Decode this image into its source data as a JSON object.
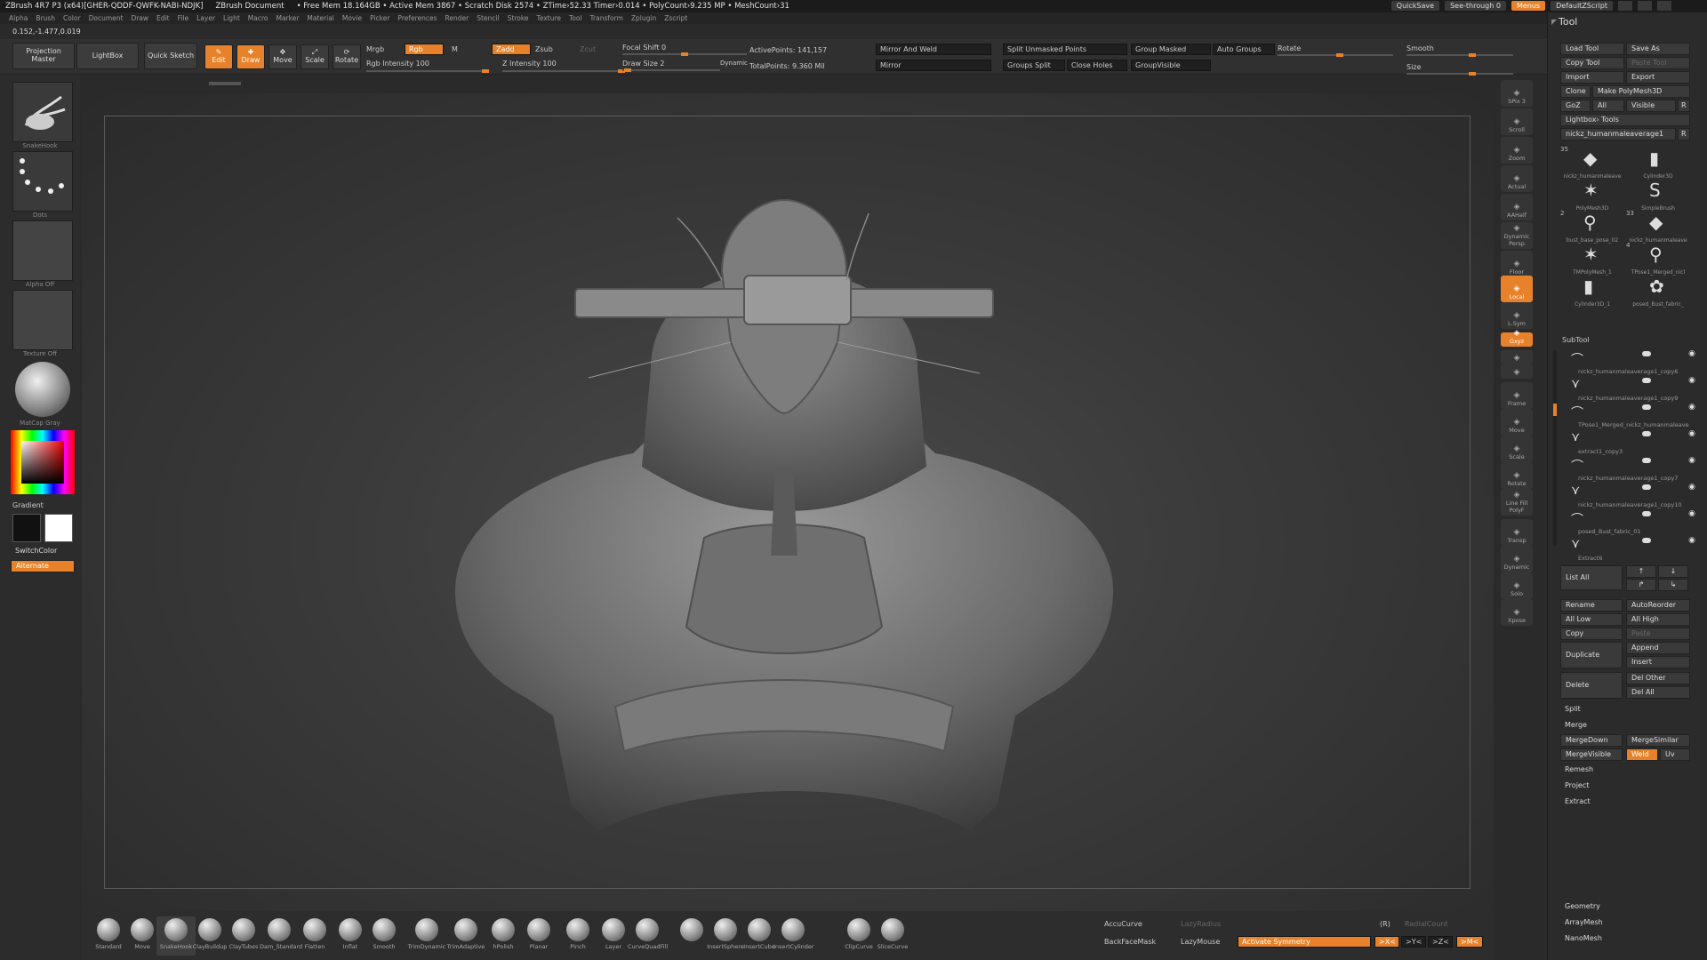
{
  "titlebar": {
    "app": "ZBrush 4R7 P3 (x64)[GHER-QDDF-QWFK-NABI-NDJK]",
    "doc": "ZBrush Document",
    "stats": "• Free Mem 18.164GB • Active Mem 3867 • Scratch Disk 2574 • ZTime›52.33 Timer›0.014 • PolyCount›9.235 MP • MeshCount›31",
    "quicksave": "QuickSave",
    "see_through": "See-through  0",
    "menus": "Menus",
    "script": "DefaultZScript"
  },
  "menubar": [
    "Alpha",
    "Brush",
    "Color",
    "Document",
    "Draw",
    "Edit",
    "File",
    "Layer",
    "Light",
    "Macro",
    "Marker",
    "Material",
    "Movie",
    "Picker",
    "Preferences",
    "Render",
    "Stencil",
    "Stroke",
    "Texture",
    "Tool",
    "Transform",
    "Zplugin",
    "Zscript"
  ],
  "coords": "0.152,-1.477,0.019",
  "topshelf": {
    "projection_master": "Projection Master",
    "lightbox": "LightBox",
    "quick_sketch": "Quick Sketch",
    "edit": "Edit",
    "draw": "Draw",
    "move": "Move",
    "scale": "Scale",
    "rotate": "Rotate",
    "mrgb": "Mrgb",
    "rgb": "Rgb",
    "m": "M",
    "zadd": "Zadd",
    "zsub": "Zsub",
    "zcut": "Zcut",
    "rgb_intensity": "Rgb Intensity 100",
    "z_intensity": "Z Intensity 100",
    "focal_shift": "Focal Shift 0",
    "draw_size": "Draw Size 2",
    "dynamic": "Dynamic",
    "active_points": "ActivePoints: 141,157",
    "total_points": "TotalPoints: 9.360 Mil",
    "mirror_and_weld": "Mirror And Weld",
    "mirror": "Mirror",
    "split_unmasked": "Split Unmasked Points",
    "groups_split": "Groups Split",
    "close_holes": "Close Holes",
    "group_masked": "Group Masked",
    "auto_groups": "Auto Groups",
    "group_visible": "GroupVisible",
    "rotate_lbl": "Rotate",
    "smooth": "Smooth",
    "size": "Size"
  },
  "leftpanel": {
    "brush_name": "SnakeHook",
    "stroke_name": "Dots",
    "alpha": "Alpha Off",
    "texture": "Texture Off",
    "material": "MatCap Gray",
    "gradient": "Gradient",
    "switch_color": "SwitchColor",
    "alternate": "Alternate"
  },
  "rightdock": [
    "SPix 3",
    "Scroll",
    "Zoom",
    "Actual",
    "AAHalf",
    "Dynamic Persp",
    "Floor",
    "Local",
    "L.Sym",
    "Gxyz",
    "",
    "",
    "Frame",
    "Move",
    "Scale",
    "Rotate",
    "Line Fill PolyF",
    "Transp",
    "Dynamic",
    "Solo",
    "Xpose"
  ],
  "toolpanel": {
    "title": "Tool",
    "load_tool": "Load Tool",
    "save_as": "Save As",
    "copy_tool": "Copy Tool",
    "paste_tool": "Paste Tool",
    "import": "Import",
    "export": "Export",
    "clone": "Clone",
    "make_polymesh": "Make PolyMesh3D",
    "goz": "GoZ",
    "all": "All",
    "visible": "Visible",
    "r": "R",
    "lightbox_tools": "Lightbox› Tools",
    "current_tool": "nickz_humanmaleaverage1",
    "tools": [
      {
        "num": "35",
        "name": "nickz_humanmaleave"
      },
      {
        "num": "",
        "name": "Cylinder3D"
      },
      {
        "num": "",
        "name": "PolyMesh3D"
      },
      {
        "num": "",
        "name": "SimpleBrush"
      },
      {
        "num": "2",
        "name": "bust_base_pose_02"
      },
      {
        "num": "33",
        "name": "nickz_humanmaleave"
      },
      {
        "num": "",
        "name": "TMPolyMesh_1"
      },
      {
        "num": "4",
        "name": "TPose1_Merged_nicl"
      },
      {
        "num": "",
        "name": "Cylinder3D_1"
      },
      {
        "num": "",
        "name": "posed_Bust_fabric_"
      }
    ],
    "subtool_title": "SubTool",
    "subtools": [
      "nickz_humanmaleaverage1_copy6",
      "nickz_humanmaleaverage1_copy9",
      "TPose1_Merged_nickz_humanmaleave",
      "extract1_copy3",
      "nickz_humanmaleaverage1_copy7",
      "nickz_humanmaleaverage1_copy10",
      "posed_Bust_fabric_01",
      "Extract6"
    ],
    "list_all": "List All",
    "rename": "Rename",
    "auto_reorder": "AutoReorder",
    "all_low": "All Low",
    "all_high": "All High",
    "copy": "Copy",
    "paste": "Paste",
    "duplicate": "Duplicate",
    "append": "Append",
    "insert": "Insert",
    "delete": "Delete",
    "del_other": "Del Other",
    "del_all": "Del All",
    "split": "Split",
    "merge": "Merge",
    "merge_down": "MergeDown",
    "merge_similar": "MergeSimilar",
    "merge_visible": "MergeVisible",
    "weld": "Weld",
    "uv": "Uv",
    "remesh": "Remesh",
    "project": "Project",
    "extract": "Extract",
    "geometry": "Geometry",
    "array_mesh": "ArrayMesh",
    "nano_mesh": "NanoMesh"
  },
  "bottomshelf": {
    "brushes": [
      "Standard",
      "Move",
      "SnakeHook",
      "ClayBuildup",
      "ClayTubes",
      "Dam_Standard",
      "Flatten",
      "Inflat",
      "Smooth",
      "TrimDynamic",
      "TrimAdaptive",
      "hPolish",
      "Planar",
      "Pinch",
      "Layer",
      "CurveQuadFill",
      "",
      "InsertSphere",
      "InsertCube",
      "InsertCylinder",
      "ClipCurve",
      "SliceCurve"
    ],
    "accucurve": "AccuCurve",
    "lazy_radius": "LazyRadius",
    "backface_mask": "BackFaceMask",
    "lazy_mouse": "LazyMouse",
    "activate_symmetry": "Activate Symmetry",
    "r_lbl": "(R)",
    "radial_count": "RadialCount",
    "sym_x": ">X<",
    "sym_y": ">Y<",
    "sym_z": ">Z<",
    "sym_m": ">M<"
  },
  "colors": {
    "accent": "#e8822a",
    "panel": "#2b2b2b",
    "viewport": "#3a3a3a"
  }
}
